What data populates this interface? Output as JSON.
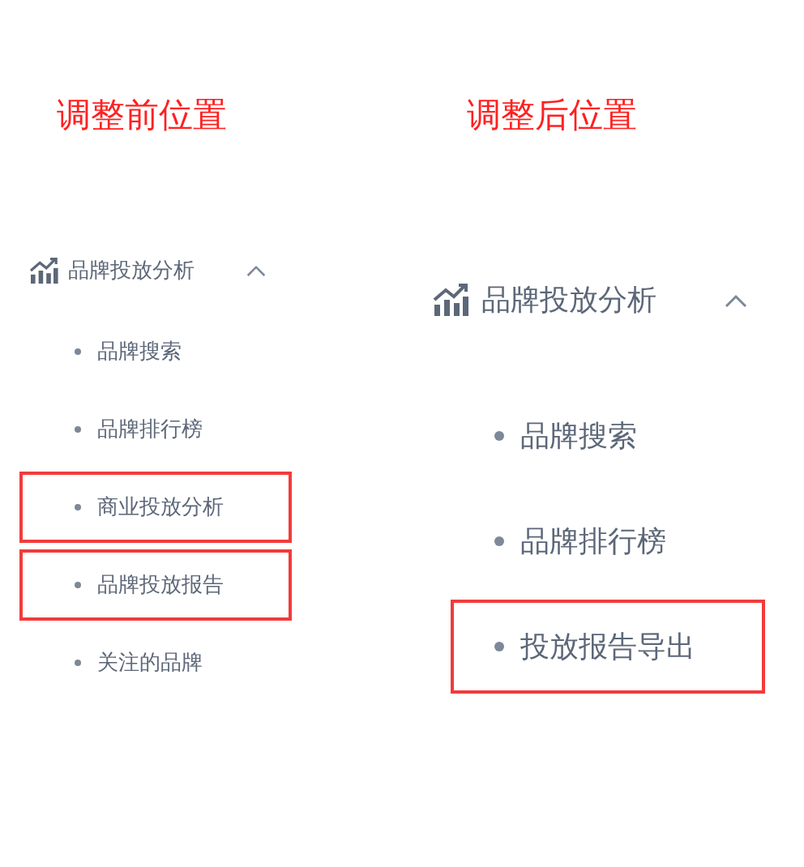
{
  "panels": [
    {
      "kind": "compact",
      "title": "调整前位置",
      "menu": {
        "label": "品牌投放分析",
        "expanded": true,
        "items": [
          {
            "label": "品牌搜索",
            "highlighted": false
          },
          {
            "label": "品牌排行榜",
            "highlighted": false
          },
          {
            "label": "商业投放分析",
            "highlighted": true
          },
          {
            "label": "品牌投放报告",
            "highlighted": true
          },
          {
            "label": "关注的品牌",
            "highlighted": false
          }
        ]
      }
    },
    {
      "kind": "large",
      "title": "调整后位置",
      "menu": {
        "label": "品牌投放分析",
        "expanded": true,
        "items": [
          {
            "label": "品牌搜索",
            "highlighted": false
          },
          {
            "label": "品牌排行榜",
            "highlighted": false
          },
          {
            "label": "投放报告导出",
            "highlighted": true
          }
        ]
      }
    }
  ]
}
